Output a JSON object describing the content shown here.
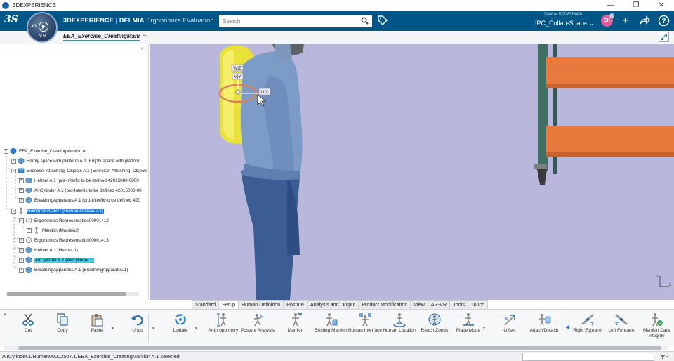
{
  "window": {
    "title": "3DEXPERIENCE",
    "minimize": "—",
    "restore": "❐",
    "close": "✕"
  },
  "app": {
    "logo": "3S",
    "compass_3d": "3D",
    "compass_version": "V.R",
    "brand": "3DEXPERIENCE",
    "separator": " | ",
    "product": "DELMIA",
    "app_name": "Ergonomics Evaluation",
    "search_placeholder": "Search",
    "user_name": "Srinivas KONATHALA",
    "collab_space": "IPC_Collab-Space",
    "avatar_initials": "SK"
  },
  "tabs": {
    "document": "EEA_Exercise_CreatingMani",
    "add": "+"
  },
  "tree": {
    "collapse": "‹",
    "nodes": [
      {
        "label": "EEA_Exercise_CreatingManikin A.1",
        "pm": "−"
      },
      {
        "label": "Empty space with platform A.1 (Empty space with platform",
        "pm": "+"
      },
      {
        "label": "Exercise_Attaching_Objects A.1 (Exercise_Attaching_Objects",
        "pm": "−"
      },
      {
        "label": "Helmet A.1 (prd-Interfix to be defined 42015080-0800",
        "pm": "+"
      },
      {
        "label": "AirCylinder A.1 (prd-Interfix to be defined 42015080-00",
        "pm": "+"
      },
      {
        "label": "BreathingApparatus A.1 (prd-Interfix to be defined 420",
        "pm": "+"
      },
      {
        "label": "Human00002507 (Human00002507.1)",
        "pm": "−"
      },
      {
        "label": "Ergonomics Representation00001412",
        "pm": "−"
      },
      {
        "label": "Manikin (Manikin3)",
        "pm": "+"
      },
      {
        "label": "Ergonomics Representation00001413",
        "pm": "+"
      },
      {
        "label": "Helmet A.1 (Helmet.1)",
        "pm": "+"
      },
      {
        "label": "AirCylinder A.1 (AirCylinder.1)",
        "pm": "+"
      },
      {
        "label": "BreathingApparatus A.1 (BreathingApparatus.1)",
        "pm": "+"
      }
    ]
  },
  "viewport": {
    "handle_labels": {
      "wz": "W|Z",
      "vy": "V|Y",
      "ux": "U|X"
    },
    "axis_x": "x",
    "axis_z": "z"
  },
  "section_tabs": [
    "Standard",
    "Setup",
    "Human Definition",
    "Posture",
    "Analysis and Output",
    "Product Modification",
    "View",
    "AR-VR",
    "Tools",
    "Touch"
  ],
  "actions": [
    {
      "label": "Cut",
      "icon": "scissors-icon"
    },
    {
      "label": "Copy",
      "icon": "copy-icon"
    },
    {
      "label": "Paste",
      "icon": "paste-icon"
    },
    {
      "label": "Undo",
      "icon": "undo-icon"
    },
    {
      "label": "Update",
      "icon": "update-icon"
    },
    {
      "label": "Anthropometry",
      "icon": "anthropometry-icon"
    },
    {
      "label": "Posture Analysis",
      "icon": "posture-analysis-icon"
    },
    {
      "label": "Manikin",
      "icon": "manikin-icon"
    },
    {
      "label": "Existing Manikin",
      "icon": "existing-manikin-icon"
    },
    {
      "label": "Human Interface",
      "icon": "human-interface-icon"
    },
    {
      "label": "Human Location",
      "icon": "human-location-icon"
    },
    {
      "label": "Reach Zones",
      "icon": "reach-zones-icon"
    },
    {
      "label": "Place Mode",
      "icon": "place-mode-icon"
    },
    {
      "label": "Offset",
      "icon": "offset-icon"
    },
    {
      "label": "Attach/Detach",
      "icon": "attach-detach-icon"
    },
    {
      "label": "Right Forearm",
      "icon": "right-forearm-icon"
    },
    {
      "label": "Left Forearm",
      "icon": "left-forearm-icon"
    },
    {
      "label": "Manikin Data Integrity",
      "icon": "manikin-integrity-icon"
    }
  ],
  "status": {
    "text": "AirCylinder.1/Human00002507.1/EEA_Exercise_CreatingManikin A.1 selected"
  },
  "colors": {
    "appbar": "#005686",
    "viewport_bg": "#b9b8dc",
    "selection_blue": "#1877d4",
    "selection_cyan": "#3ed0e0"
  }
}
